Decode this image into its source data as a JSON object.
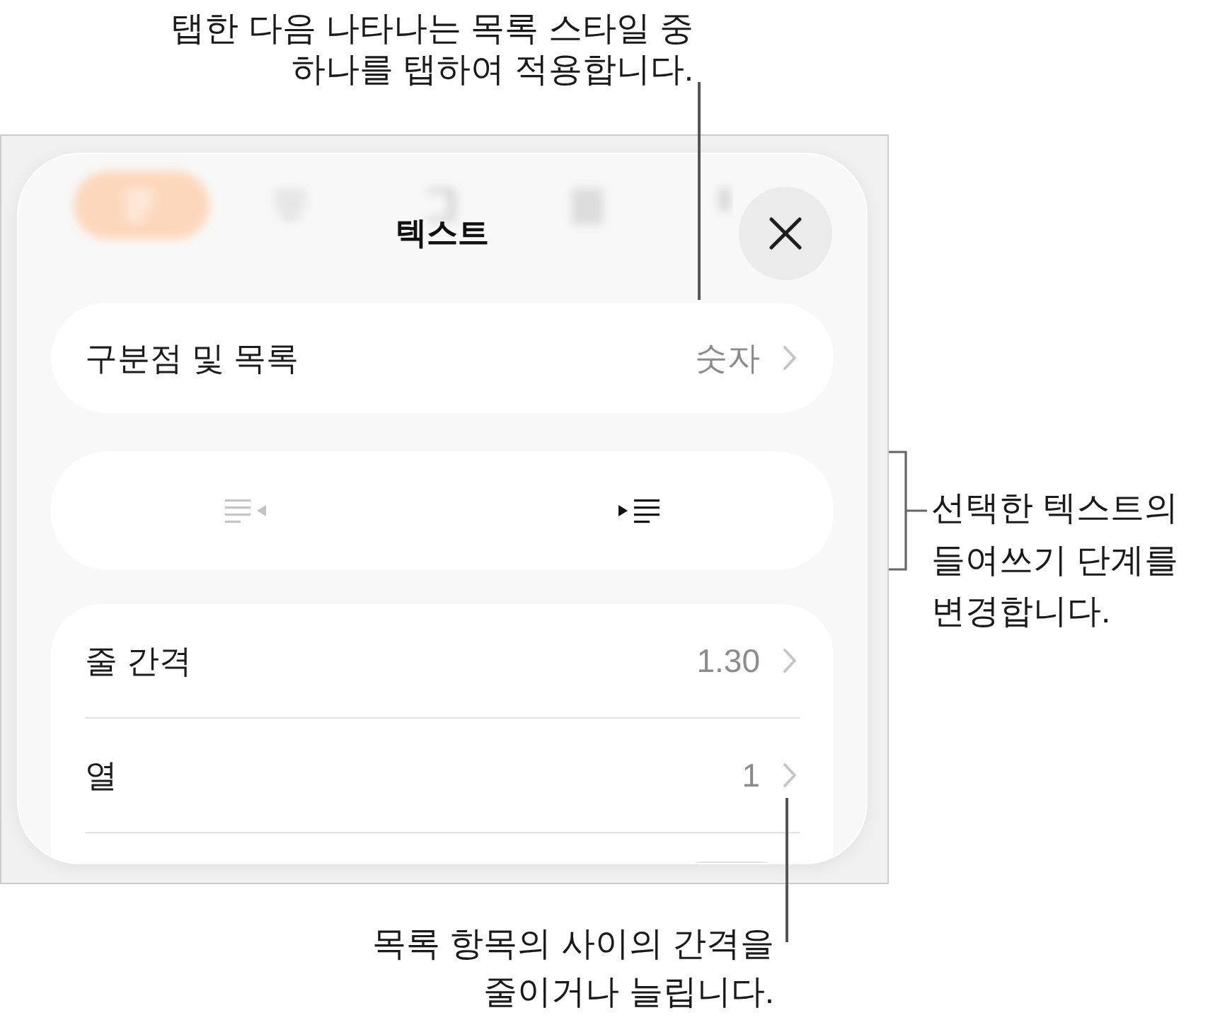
{
  "top_callout": {
    "text": "탭한 다음 나타나는 목록 스타일 중\n하나를 탭하여 적용합니다."
  },
  "panel": {
    "title": "텍스트",
    "list_style": {
      "label": "구분점 및 목록",
      "value": "숫자"
    },
    "indent_buttons": [
      {
        "kind": "outdent",
        "disabled": true
      },
      {
        "kind": "indent",
        "disabled": false
      }
    ],
    "spacing_rows": [
      {
        "label": "줄 간격",
        "value": "1.30"
      },
      {
        "label": "열",
        "value": "1"
      }
    ]
  },
  "right_callout": {
    "text": "선택한 텍스트의\n들여쓰기 단계를\n변경합니다."
  },
  "bottom_callout": {
    "text": "목록 항목의 사이의 간격을\n줄이거나 늘립니다."
  }
}
